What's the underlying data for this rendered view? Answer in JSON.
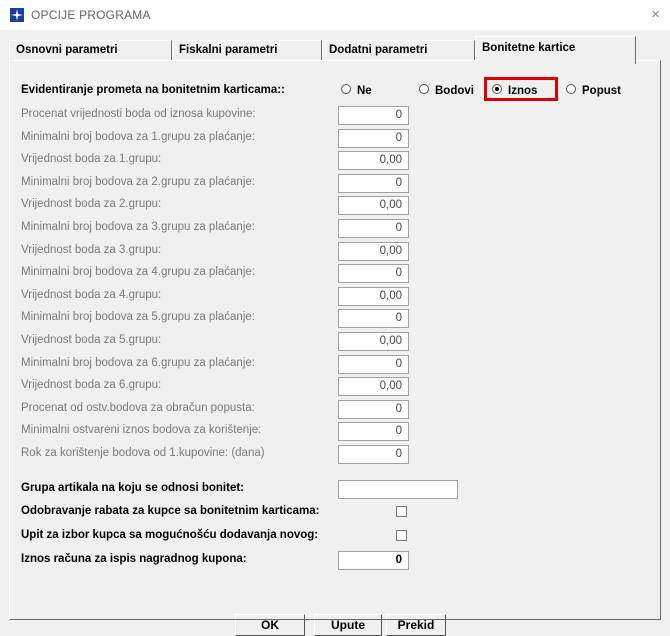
{
  "window": {
    "title": "OPCIJE PROGRAMA",
    "close_label": "×"
  },
  "tabs": [
    {
      "label": "Osnovni parametri",
      "active": false
    },
    {
      "label": "Fiskalni parametri",
      "active": false
    },
    {
      "label": "Dodatni parametri",
      "active": false
    },
    {
      "label": "Bonitetne kartice",
      "active": true
    }
  ],
  "evidentiranje": {
    "label": "Evidentiranje prometa na bonitetnim karticama::",
    "options": [
      "Ne",
      "Bodovi",
      "Iznos",
      "Popust"
    ],
    "selected": "Iznos"
  },
  "fields": [
    {
      "label": "Procenat vrijednosti boda od iznosa kupovine:",
      "value": "0"
    },
    {
      "label": "Minimalni broj bodova za 1.grupu za plaćanje:",
      "value": "0"
    },
    {
      "label": "Vrijednost boda za 1.grupu:",
      "value": "0,00"
    },
    {
      "label": "Minimalni broj bodova za 2.grupu za plaćanje:",
      "value": "0"
    },
    {
      "label": "Vrijednost boda za 2.grupu:",
      "value": "0,00"
    },
    {
      "label": "Minimalni broj bodova za 3.grupu za plaćanje:",
      "value": "0"
    },
    {
      "label": "Vrijednost boda za 3.grupu:",
      "value": "0,00"
    },
    {
      "label": "Minimalni broj bodova za 4.grupu za plaćanje:",
      "value": "0"
    },
    {
      "label": "Vrijednost boda za 4.grupu:",
      "value": "0,00"
    },
    {
      "label": "Minimalni broj bodova za 5.grupu za plaćanje:",
      "value": "0"
    },
    {
      "label": "Vrijednost boda za 5.grupu:",
      "value": "0,00"
    },
    {
      "label": "Minimalni broj bodova za 6.grupu za plaćanje:",
      "value": "0"
    },
    {
      "label": "Vrijednost boda za 6.grupu:",
      "value": "0,00"
    },
    {
      "label": "Procenat od ostv.bodova za obračun popusta:",
      "value": "0"
    },
    {
      "label": "Minimalni ostvareni iznos bodova za korištenje:",
      "value": "0"
    },
    {
      "label": "Rok za korištenje bodova od 1.kupovine: (dana)",
      "value": "0"
    }
  ],
  "grupa": {
    "label": "Grupa artikala na koju se odnosi bonitet:",
    "value": ""
  },
  "checkboxes": [
    {
      "label": "Odobravanje rabata za kupce sa bonitetnim karticama:",
      "checked": false
    },
    {
      "label": "Upit za izbor kupca sa mogućnošću dodavanja novog:",
      "checked": false
    }
  ],
  "kupon": {
    "label": "Iznos računa za ispis nagradnog kupona:",
    "value": "0"
  },
  "buttons": {
    "ok": "OK",
    "upute": "Upute",
    "prekid": "Prekid"
  }
}
